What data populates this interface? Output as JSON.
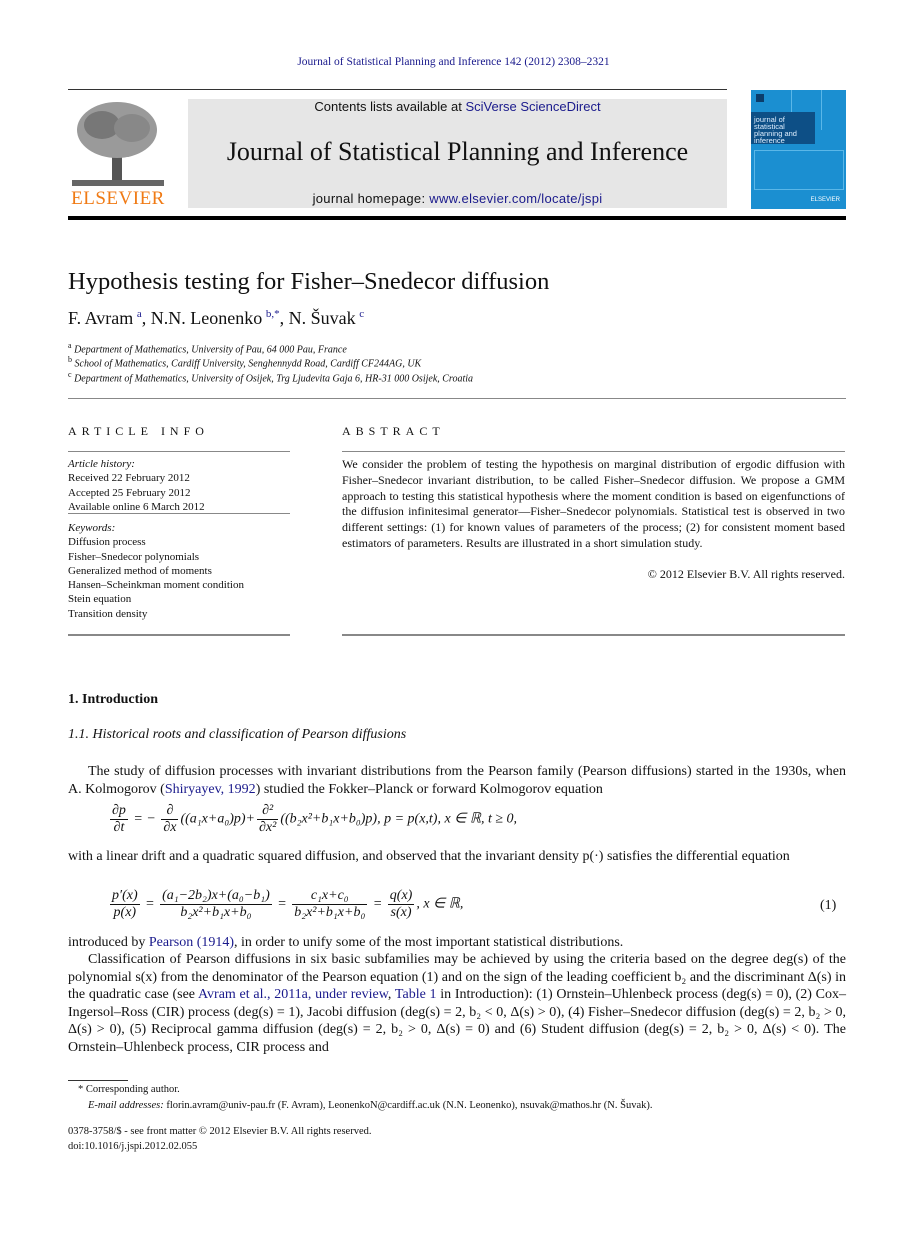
{
  "header": {
    "journal_ref": "Journal of Statistical Planning and Inference 142 (2012) 2308–2321",
    "contents_prefix": "Contents lists available at ",
    "contents_link": "SciVerse ScienceDirect",
    "journal_title": "Journal of Statistical Planning and Inference",
    "homepage_prefix": "journal homepage: ",
    "homepage_link": "www.elsevier.com/locate/jspi",
    "publisher_logo": "ELSEVIER",
    "cover_text": "journal of statistical planning and inference",
    "cover_publisher": "ELSEVIER"
  },
  "article": {
    "title": "Hypothesis testing for Fisher–Snedecor diffusion",
    "authors": [
      {
        "name": "F. Avram",
        "sup": "a"
      },
      {
        "name": "N.N. Leonenko",
        "sup": "b,*"
      },
      {
        "name": "N. Šuvak",
        "sup": "c"
      }
    ],
    "affiliations": [
      {
        "sup": "a",
        "text": "Department of Mathematics, University of Pau, 64 000 Pau, France"
      },
      {
        "sup": "b",
        "text": "School of Mathematics, Cardiff University, Senghennydd Road, Cardiff CF244AG, UK"
      },
      {
        "sup": "c",
        "text": "Department of Mathematics, University of Osijek, Trg Ljudevita Gaja 6, HR-31 000 Osijek, Croatia"
      }
    ]
  },
  "article_info": {
    "heading": "ARTICLE INFO",
    "history_label": "Article history:",
    "history": [
      "Received 22 February 2012",
      "Accepted 25 February 2012",
      "Available online 6 March 2012"
    ],
    "keywords_label": "Keywords:",
    "keywords": [
      "Diffusion process",
      "Fisher–Snedecor polynomials",
      "Generalized method of moments",
      "Hansen–Scheinkman moment condition",
      "Stein equation",
      "Transition density"
    ]
  },
  "abstract": {
    "heading": "ABSTRACT",
    "text": "We consider the problem of testing the hypothesis on marginal distribution of ergodic diffusion with Fisher–Snedecor invariant distribution, to be called Fisher–Snedecor diffusion. We propose a GMM approach to testing this statistical hypothesis where the moment condition is based on eigenfunctions of the diffusion infinitesimal generator—Fisher–Snedecor polynomials. Statistical test is observed in two different settings: (1) for known values of parameters of the process; (2) for consistent moment based estimators of parameters. Results are illustrated in a short simulation study.",
    "copyright": "© 2012 Elsevier B.V. All rights reserved."
  },
  "body": {
    "section_heading": "1.  Introduction",
    "subsection_heading": "1.1.  Historical roots and classification of Pearson diffusions",
    "p1_a": "The study of diffusion processes with invariant distributions from the Pearson family (Pearson diffusions) started in the 1930s, when A. Kolmogorov (",
    "p1_link": "Shiryayev, 1992",
    "p1_b": ") studied the Fokker–Planck or forward Kolmogorov equation",
    "eq_kolmogorov_rhs": "((a₁x+a₀)p)+",
    "eq_kolmogorov_tail": "((b₂x²+b₁x+b₀)p),     p = p(x,t),  x ∈ ℝ, t ≥ 0,",
    "p2": "with a linear drift and a quadratic squared diffusion, and observed that the invariant density p(·) satisfies the differential equation",
    "eq1_tail": ",    x ∈ ℝ,",
    "eq1_number": "(1)",
    "p3_a": "introduced by ",
    "p3_link": "Pearson (1914)",
    "p3_b": ", in order to unify some of the most important statistical distributions.",
    "p4_a": "Classification of Pearson diffusions in six basic subfamilies may be achieved by using the criteria based on the degree deg(s) of the polynomial s(x) from the denominator of the Pearson equation (1) and on the sign of the leading coefficient b₂ and the discriminant Δ(s) in the quadratic case (see ",
    "p4_link1": "Avram et al., 2011a, under review",
    "p4_sep": ", ",
    "p4_link2": "Table 1",
    "p4_b": " in Introduction): (1) Ornstein–Uhlenbeck process (deg(s) = 0), (2) Cox–Ingersol–Ross (CIR) process (deg(s) = 1), Jacobi diffusion (deg(s) = 2, b₂ < 0, Δ(s) > 0), (4) Fisher–Snedecor diffusion (deg(s) = 2, b₂ > 0, Δ(s) > 0), (5) Reciprocal gamma diffusion (deg(s) = 2, b₂ > 0, Δ(s) = 0) and (6) Student diffusion (deg(s) = 2, b₂ > 0, Δ(s) < 0). The Ornstein–Uhlenbeck process, CIR process and"
  },
  "footnotes": {
    "corresponding": "* Corresponding author.",
    "email_label": "E-mail addresses:",
    "emails": " florin.avram@univ-pau.fr (F. Avram), LeonenkoN@cardiff.ac.uk (N.N. Leonenko), nsuvak@mathos.hr (N. Šuvak).",
    "issn": "0378-3758/$ - see front matter © 2012 Elsevier B.V. All rights reserved.",
    "doi": "doi:10.1016/j.jspi.2012.02.055"
  }
}
